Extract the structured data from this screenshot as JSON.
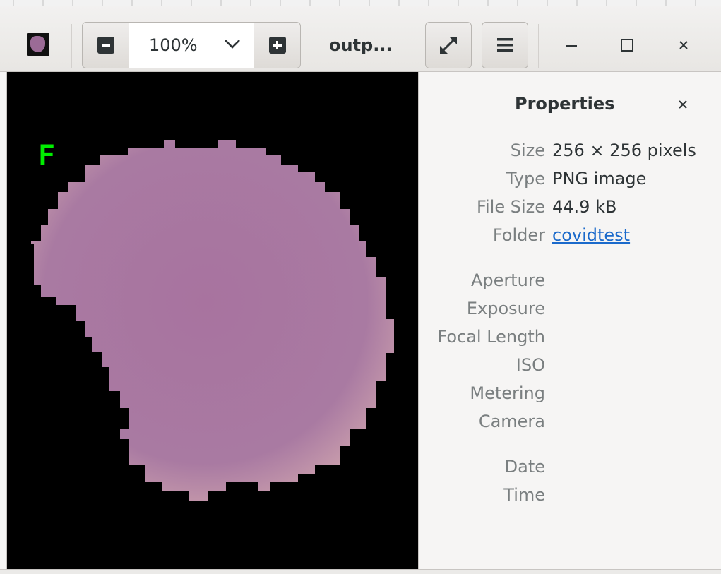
{
  "header": {
    "title": "outp...",
    "zoom": {
      "value": "100%"
    }
  },
  "icons": {
    "zoom_out": "minus-square-icon",
    "zoom_dropdown": "chevron-down-icon",
    "zoom_in": "plus-square-icon",
    "fullscreen": "expand-arrows-icon",
    "menu": "hamburger-menu-icon",
    "minimize": "minimize-icon",
    "maximize": "maximize-icon",
    "close": "close-icon"
  },
  "image": {
    "overlay_text": "F"
  },
  "properties": {
    "title": "Properties",
    "rows": [
      {
        "label": "Size",
        "value": "256 × 256 pixels"
      },
      {
        "label": "Type",
        "value": "PNG image"
      },
      {
        "label": "File Size",
        "value": "44.9 kB"
      },
      {
        "label": "Folder",
        "value": "covidtest"
      },
      {
        "label": "Aperture",
        "value": ""
      },
      {
        "label": "Exposure",
        "value": ""
      },
      {
        "label": "Focal Length",
        "value": ""
      },
      {
        "label": "ISO",
        "value": ""
      },
      {
        "label": "Metering",
        "value": ""
      },
      {
        "label": "Camera",
        "value": ""
      },
      {
        "label": "Date",
        "value": ""
      },
      {
        "label": "Time",
        "value": ""
      }
    ]
  },
  "colors": {
    "link": "#1b6acb",
    "overlay_text": "#00ee00",
    "cell": "#a8739f",
    "image_background": "#000000"
  }
}
